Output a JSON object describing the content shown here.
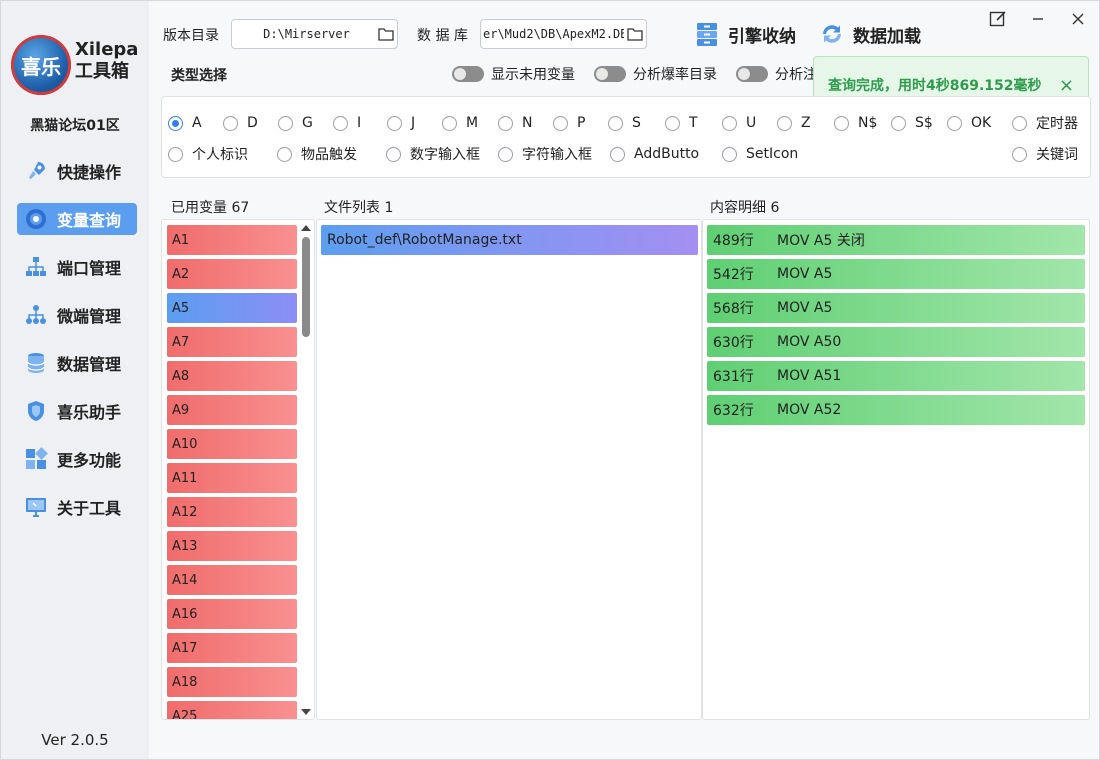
{
  "app": {
    "logo_glyph": "喜乐",
    "name_line1": "Xilepa",
    "name_line2": "工具箱",
    "forum": "黑猫论坛01区",
    "version": "Ver 2.0.5"
  },
  "sidebar": {
    "items": [
      {
        "label": "快捷操作",
        "icon": "rocket-icon"
      },
      {
        "label": "变量查询",
        "icon": "target-icon"
      },
      {
        "label": "端口管理",
        "icon": "network-icon"
      },
      {
        "label": "微端管理",
        "icon": "tree-icon"
      },
      {
        "label": "数据管理",
        "icon": "database-icon"
      },
      {
        "label": "喜乐助手",
        "icon": "shield-icon"
      },
      {
        "label": "更多功能",
        "icon": "apps-icon"
      },
      {
        "label": "关于工具",
        "icon": "monitor-icon"
      }
    ],
    "active_index": 1
  },
  "toolbar": {
    "version_dir_label": "版本目录",
    "version_dir_value": "D:\\Mirserver",
    "db_label": "数 据 库",
    "db_value": "er\\Mud2\\DB\\ApexM2.DB",
    "engine_btn": "引擎收纳",
    "load_btn": "数据加载",
    "type_select_label": "类型选择",
    "toggles": [
      {
        "label": "显示未用变量",
        "on": false
      },
      {
        "label": "分析爆率目录",
        "on": false
      },
      {
        "label": "分析注",
        "on": false
      }
    ]
  },
  "toast": {
    "message": "查询完成，用时4秒869.152毫秒",
    "close": "×"
  },
  "types": {
    "row1": [
      "A",
      "D",
      "G",
      "I",
      "J",
      "M",
      "N",
      "P",
      "S",
      "T",
      "U",
      "Z",
      "N$",
      "S$",
      "OK",
      "定时器"
    ],
    "row2": [
      "个人标识",
      "物品触发",
      "数字输入框",
      "字符输入框",
      "AddButto",
      "SetIcon",
      "关键词"
    ],
    "selected": "A"
  },
  "columns": {
    "used_vars_title": "已用变量 67",
    "file_list_title": "文件列表 1",
    "detail_title": "内容明细 6"
  },
  "variables": [
    "A1",
    "A2",
    "A5",
    "A7",
    "A8",
    "A9",
    "A10",
    "A11",
    "A12",
    "A13",
    "A14",
    "A16",
    "A17",
    "A18",
    "A25"
  ],
  "selected_variable": "A5",
  "files": [
    "Robot_def\\RobotManage.txt"
  ],
  "details": [
    {
      "line": "489行",
      "text": "MOV A5 关闭"
    },
    {
      "line": "542行",
      "text": "MOV A5"
    },
    {
      "line": "568行",
      "text": "MOV A5"
    },
    {
      "line": "630行",
      "text": "MOV A50"
    },
    {
      "line": "631行",
      "text": "MOV A51"
    },
    {
      "line": "632行",
      "text": "MOV A52"
    }
  ]
}
